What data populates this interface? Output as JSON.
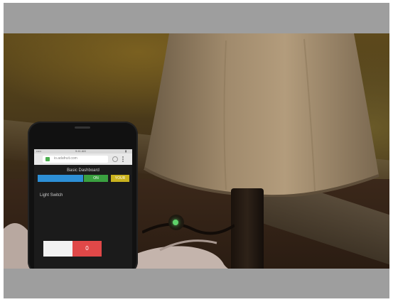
{
  "scene": {
    "description_icons": [
      "lamp-shade-icon",
      "phone-icon",
      "smart-plug-icon"
    ],
    "colors": {
      "frame": "#9e9e9e",
      "tab_blue": "#2d8fd6",
      "tab_green": "#3aa040",
      "tab_yellow": "#c9b21e",
      "toggle_on": "#e04848",
      "led": "#5fd26a"
    }
  },
  "phone": {
    "status_left": "••••• ",
    "status_time": "9:41 AM",
    "status_right": "▮",
    "url": "io.adafruit.com",
    "dashboard_title": "Basic Dashboard",
    "tabs": [
      {
        "label": ""
      },
      {
        "label": "ON"
      },
      {
        "label": "YOUR"
      }
    ],
    "light_switch_label": "Light Switch",
    "toggle_on_label": "0"
  }
}
